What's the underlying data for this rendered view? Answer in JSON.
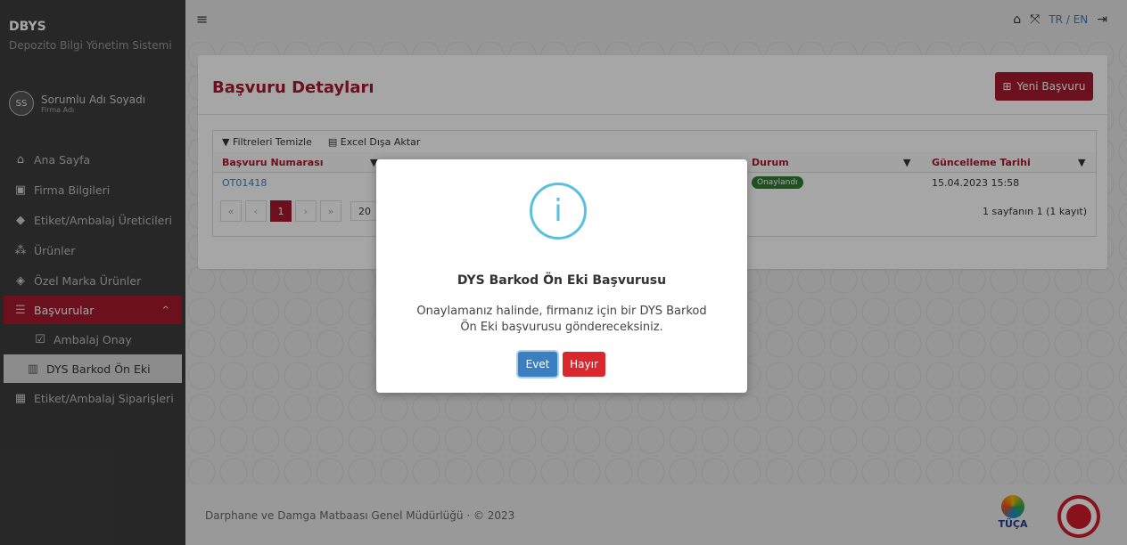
{
  "app": {
    "brand": "DBYS",
    "brand_sub": "Depozito Bilgi Yönetim Sistemi",
    "user_initials": "SS",
    "user_name": "Sorumlu Adı Soyadı",
    "user_firm": "Firma Adı"
  },
  "sidebar": {
    "items": [
      {
        "label": "Ana Sayfa",
        "icon": "home-icon"
      },
      {
        "label": "Firma Bilgileri",
        "icon": "briefcase-icon"
      },
      {
        "label": "Etiket/Ambalaj Üreticileri",
        "icon": "tags-icon"
      },
      {
        "label": "Ürünler",
        "icon": "cubes-icon"
      },
      {
        "label": "Özel Marka Ürünler",
        "icon": "cube-icon"
      },
      {
        "label": "Başvurular",
        "icon": "list-icon"
      },
      {
        "label": "Ambalaj Onay",
        "icon": "check-box-icon"
      },
      {
        "label": "DYS Barkod Ön Eki",
        "icon": "barcode-icon"
      },
      {
        "label": "Etiket/Ambalaj Siparişleri",
        "icon": "grid-icon"
      }
    ]
  },
  "topbar": {
    "lang_tr": "TR",
    "lang_sep": "/",
    "lang_en": "EN"
  },
  "page": {
    "title": "Başvuru Detayları",
    "new_button": "Yeni Başvuru",
    "toolbar": {
      "clear_filters": "Filtreleri Temizle",
      "export_excel": "Excel Dışa Aktar"
    },
    "columns": [
      "Başvuru Numarası",
      "Durum",
      "Güncelleme Tarihi"
    ],
    "rows": [
      {
        "number": "OT01418",
        "status": "Onaylandı",
        "updated": "15.04.2023 15:58"
      }
    ],
    "pager": {
      "current": "1",
      "page_size": "20",
      "summary": "1 sayfanın 1 (1 kayıt)"
    }
  },
  "footer": {
    "text": "Darphane ve Damga Matbaası Genel Müdürlüğü · © 2023",
    "logo_text": "TÜÇA"
  },
  "modal": {
    "title": "DYS Barkod Ön Eki Başvurusu",
    "text": "Onaylamanız halinde, firmanız için bir DYS Barkod Ön Eki başvurusu göndereceksiniz.",
    "yes": "Evet",
    "no": "Hayır"
  },
  "colors": {
    "accent": "#a6192e",
    "sidebar": "#3d3d3d",
    "info": "#5bc0de",
    "primary": "#3a7fc1",
    "danger": "#d9272d",
    "success": "#2e7d32"
  }
}
